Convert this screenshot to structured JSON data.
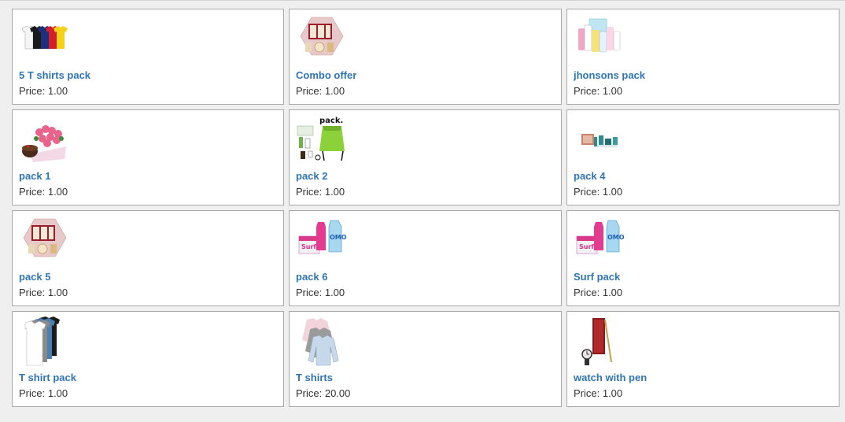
{
  "products": [
    {
      "name": "5 T shirts pack",
      "price_label": "Price: 1.00",
      "image": "tshirts-pack-image"
    },
    {
      "name": "Combo offer",
      "price_label": "Price: 1.00",
      "image": "gift-box-image"
    },
    {
      "name": "jhonsons pack",
      "price_label": "Price: 1.00",
      "image": "baby-care-image"
    },
    {
      "name": "pack 1",
      "price_label": "Price: 1.00",
      "image": "flowers-cake-image"
    },
    {
      "name": "pack 2",
      "price_label": "Price: 1.00",
      "image": "bag-pack-image"
    },
    {
      "name": "pack 4",
      "price_label": "Price: 1.00",
      "image": "cosmetics-image"
    },
    {
      "name": "pack 5",
      "price_label": "Price: 1.00",
      "image": "gift-box-image"
    },
    {
      "name": "pack 6",
      "price_label": "Price: 1.00",
      "image": "detergent-image"
    },
    {
      "name": "Surf pack",
      "price_label": "Price: 1.00",
      "image": "detergent-image"
    },
    {
      "name": "T shirt pack",
      "price_label": "Price: 1.00",
      "image": "stacked-tshirts-image"
    },
    {
      "name": "T shirts",
      "price_label": "Price: 20.00",
      "image": "long-sleeve-shirts-image"
    },
    {
      "name": "watch with pen",
      "price_label": "Price: 1.00",
      "image": "watch-pen-image"
    }
  ],
  "image_caption_pack2": "pack.",
  "colors": {
    "link": "#2f75b6",
    "text": "#333333",
    "border": "#a8a8a8",
    "background": "#efefef"
  }
}
